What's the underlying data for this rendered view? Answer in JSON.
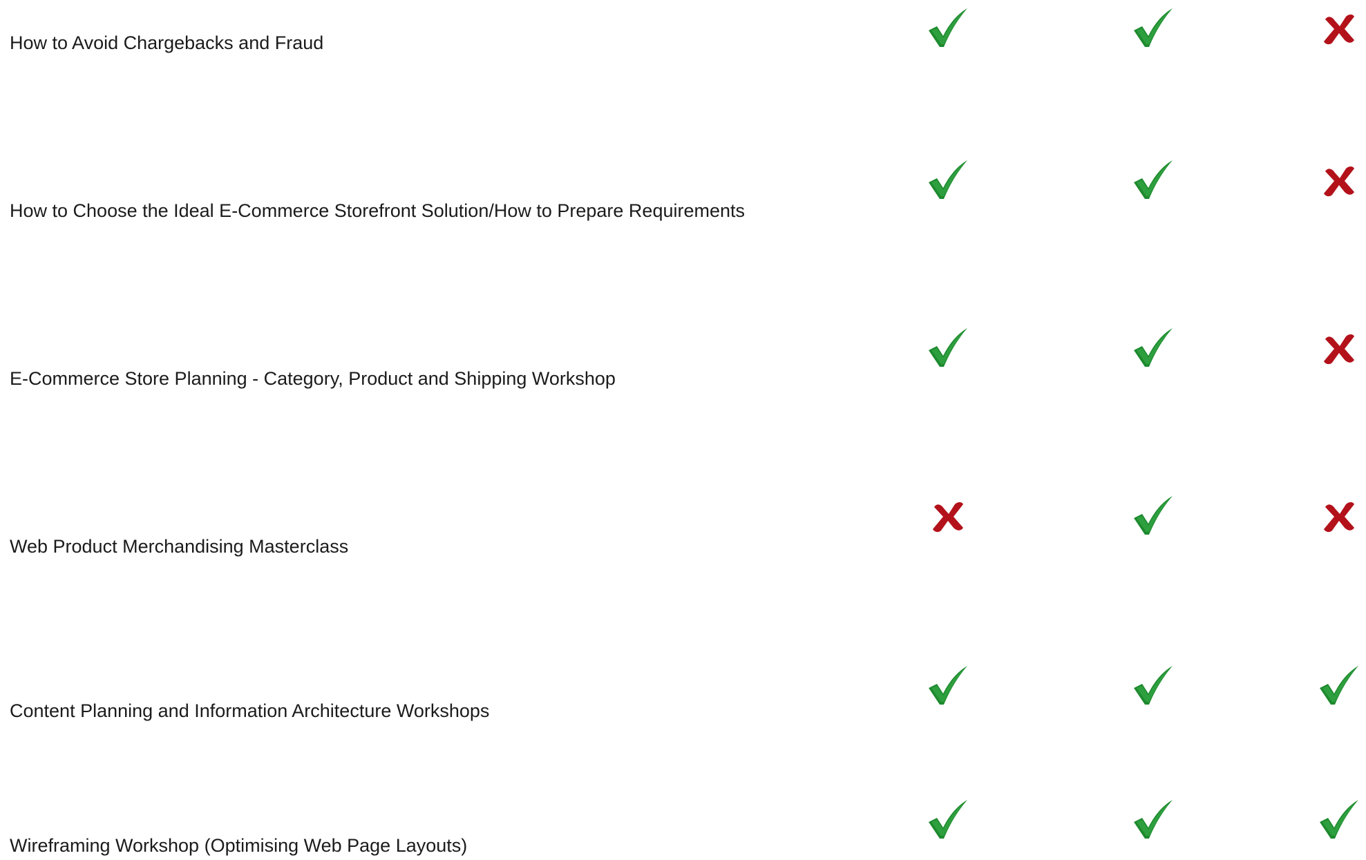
{
  "rows": [
    {
      "label": "How to Avoid Chargebacks and Fraud",
      "cols": [
        "check",
        "check",
        "cross"
      ]
    },
    {
      "label": "How to Choose the Ideal E-Commerce Storefront Solution/How to Prepare Requirements",
      "cols": [
        "check",
        "check",
        "cross"
      ]
    },
    {
      "label": "E-Commerce Store Planning - Category, Product and Shipping Workshop",
      "cols": [
        "check",
        "check",
        "cross"
      ]
    },
    {
      "label": "Web Product Merchandising Masterclass",
      "cols": [
        "cross",
        "check",
        "cross"
      ]
    },
    {
      "label": "Content Planning and Information Architecture Workshops",
      "cols": [
        "check",
        "check",
        "check"
      ]
    },
    {
      "label": "Wireframing Workshop (Optimising Web Page Layouts)",
      "cols": [
        "check",
        "check",
        "check"
      ]
    }
  ],
  "icons": {
    "check": "check-icon",
    "cross": "cross-icon"
  },
  "colors": {
    "check": "#1e8a2e",
    "cross": "#b3121b",
    "text": "#1b1b1b"
  }
}
